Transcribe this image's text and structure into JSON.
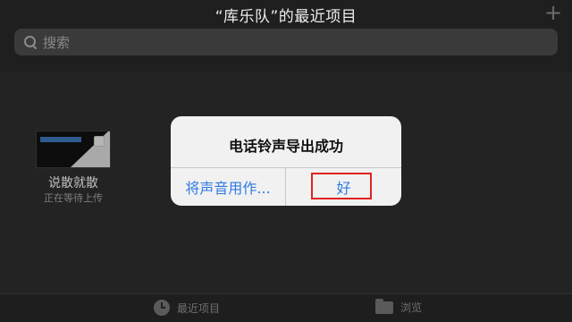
{
  "header": {
    "title": "“库乐队”的最近项目",
    "add_icon": "plus-icon"
  },
  "search": {
    "placeholder": "搜索",
    "icon": "search-icon"
  },
  "recent_item": {
    "name": "说散就散",
    "status": "正在等待上传"
  },
  "alert": {
    "title": "电话铃声导出成功",
    "left_button": "将声音用作...",
    "right_button": "好",
    "highlight_color": "#e32222",
    "button_color": "#2f7ae5"
  },
  "tabbar": {
    "recent": {
      "label": "最近项目",
      "icon": "clock-icon"
    },
    "browse": {
      "label": "浏览",
      "icon": "folder-icon"
    }
  }
}
